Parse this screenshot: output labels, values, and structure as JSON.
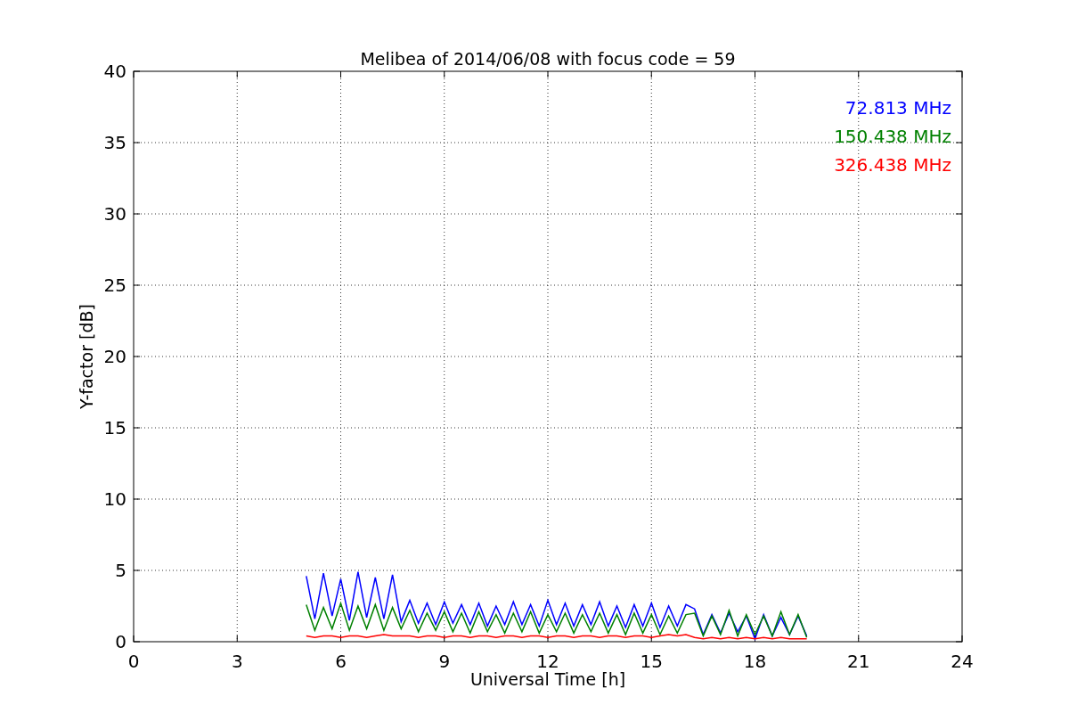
{
  "figure": {
    "chart_data": {
      "type": "line",
      "grid": true,
      "title": "Melibea of 2014/06/08 with focus code = 59",
      "xlabel": "Universal Time [h]",
      "ylabel": "Y-factor [dB]",
      "xlim": [
        0,
        24
      ],
      "ylim": [
        0,
        40
      ],
      "xticks": [
        0,
        3,
        6,
        9,
        12,
        15,
        18,
        21,
        24
      ],
      "yticks": [
        0,
        5,
        10,
        15,
        20,
        25,
        30,
        35,
        40
      ],
      "x": [
        5,
        5.25,
        5.5,
        5.75,
        6,
        6.25,
        6.5,
        6.75,
        7,
        7.25,
        7.5,
        7.75,
        8,
        8.25,
        8.5,
        8.75,
        9,
        9.25,
        9.5,
        9.75,
        10,
        10.25,
        10.5,
        10.75,
        11,
        11.25,
        11.5,
        11.75,
        12,
        12.25,
        12.5,
        12.75,
        13,
        13.25,
        13.5,
        13.75,
        14,
        14.25,
        14.5,
        14.75,
        15,
        15.25,
        15.5,
        15.75,
        16,
        16.25,
        16.5,
        16.75,
        17,
        17.25,
        17.5,
        17.75,
        18,
        18.25,
        18.5,
        18.75,
        19,
        19.25,
        19.5
      ],
      "series": [
        {
          "name": "72.813 MHz",
          "color": "#0000ff",
          "values": [
            4.6,
            1.6,
            4.8,
            1.8,
            4.4,
            1.5,
            4.9,
            1.7,
            4.5,
            1.6,
            4.7,
            1.4,
            2.9,
            1.3,
            2.7,
            1.2,
            2.8,
            1.3,
            2.6,
            1.2,
            2.7,
            1.1,
            2.5,
            1.2,
            2.8,
            1.2,
            2.6,
            1.1,
            2.9,
            1.2,
            2.7,
            1.1,
            2.6,
            1.2,
            2.8,
            1.1,
            2.5,
            1.0,
            2.6,
            1.1,
            2.7,
            1.0,
            2.5,
            1.1,
            2.6,
            2.3,
            0.5,
            1.9,
            0.6,
            2.0,
            0.7,
            1.8,
            0.2,
            1.9,
            0.4,
            1.7,
            0.5,
            1.8,
            0.4
          ]
        },
        {
          "name": "150.438 MHz",
          "color": "#008000",
          "values": [
            2.6,
            0.8,
            2.4,
            0.9,
            2.7,
            0.8,
            2.5,
            0.9,
            2.6,
            0.8,
            2.4,
            0.9,
            2.2,
            0.7,
            2.0,
            0.8,
            2.1,
            0.7,
            2.0,
            0.6,
            2.1,
            0.7,
            1.9,
            0.6,
            2.0,
            0.7,
            2.1,
            0.6,
            1.9,
            0.7,
            2.0,
            0.6,
            1.9,
            0.7,
            2.0,
            0.6,
            1.9,
            0.5,
            2.0,
            0.6,
            1.9,
            0.5,
            1.8,
            0.6,
            1.9,
            2.0,
            0.4,
            1.8,
            0.5,
            2.2,
            0.4,
            1.9,
            0.5,
            1.8,
            0.4,
            2.1,
            0.5,
            1.9,
            0.3
          ]
        },
        {
          "name": "326.438 MHz",
          "color": "#ff0000",
          "values": [
            0.4,
            0.3,
            0.4,
            0.4,
            0.3,
            0.4,
            0.4,
            0.3,
            0.4,
            0.5,
            0.4,
            0.4,
            0.4,
            0.3,
            0.4,
            0.4,
            0.3,
            0.4,
            0.4,
            0.3,
            0.4,
            0.4,
            0.3,
            0.4,
            0.4,
            0.3,
            0.4,
            0.4,
            0.3,
            0.4,
            0.4,
            0.3,
            0.4,
            0.4,
            0.3,
            0.4,
            0.4,
            0.3,
            0.4,
            0.4,
            0.3,
            0.4,
            0.5,
            0.4,
            0.5,
            0.3,
            0.2,
            0.3,
            0.2,
            0.3,
            0.2,
            0.3,
            0.2,
            0.3,
            0.2,
            0.3,
            0.2,
            0.2,
            0.2
          ]
        }
      ]
    }
  }
}
